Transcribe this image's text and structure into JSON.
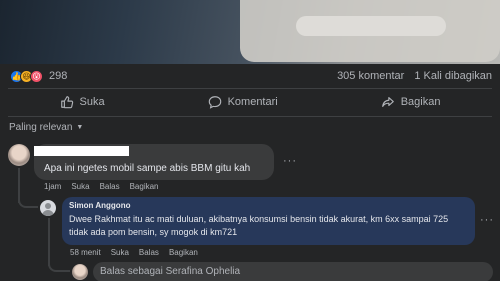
{
  "post": {
    "reaction_count": "298",
    "comment_count": "305 komentar",
    "share_count": "1 Kali dibagikan",
    "reactions": [
      "like",
      "haha",
      "wow"
    ]
  },
  "actions": {
    "like": "Suka",
    "comment": "Komentari",
    "share": "Bagikan"
  },
  "sort": {
    "label": "Paling relevan"
  },
  "comments": [
    {
      "text": "Apa ini ngetes mobil sampe abis BBM gitu kah",
      "time": "1jam",
      "like": "Suka",
      "reply": "Balas",
      "share": "Bagikan",
      "menu": "···"
    },
    {
      "name": "Simon Anggono",
      "text": "Dwee Rakhmat itu ac mati duluan, akibatnya konsumsi bensin tidak akurat, km 6xx sampai 725 tidak ada pom bensin, sy mogok di km721",
      "time": "58 menit",
      "like": "Suka",
      "reply": "Balas",
      "share": "Bagikan",
      "menu": "···"
    }
  ],
  "reply_box": {
    "placeholder": "Balas sebagai Serafina Ophelia"
  },
  "colors": {
    "background": "#242526",
    "bubble": "#3a3b3c",
    "highlight_bubble": "#27385a",
    "like_blue": "#1877f2"
  }
}
